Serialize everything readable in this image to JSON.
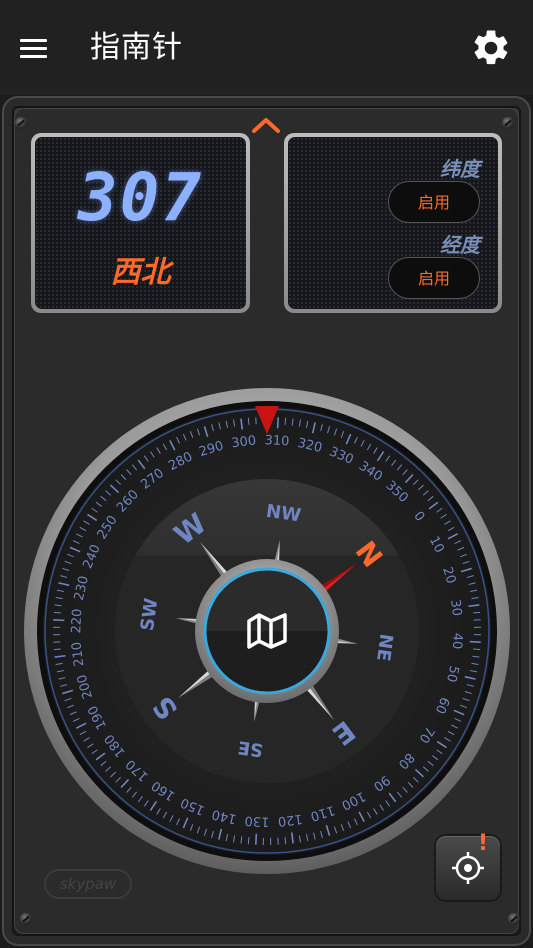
{
  "app": {
    "title": "指南针",
    "menu_icon": "menu-icon",
    "settings_icon": "gear-icon"
  },
  "heading": {
    "degrees": "307",
    "direction": "西北"
  },
  "coords": {
    "latitude_label": "纬度",
    "latitude_button": "启用",
    "longitude_label": "经度",
    "longitude_button": "启用"
  },
  "compass": {
    "heading_deg": 307,
    "cardinals": [
      "N",
      "NE",
      "E",
      "SE",
      "S",
      "SW",
      "W",
      "NW"
    ],
    "center_icon": "map-icon"
  },
  "footer": {
    "brand": "skypaw",
    "locate_icon": "crosshair-icon",
    "alert": "!"
  },
  "colors": {
    "accent": "#ff6a2a",
    "lcd_blue": "#8db0ff",
    "dial_blue": "#6f86c2",
    "ring_cyan": "#35a8e0"
  }
}
